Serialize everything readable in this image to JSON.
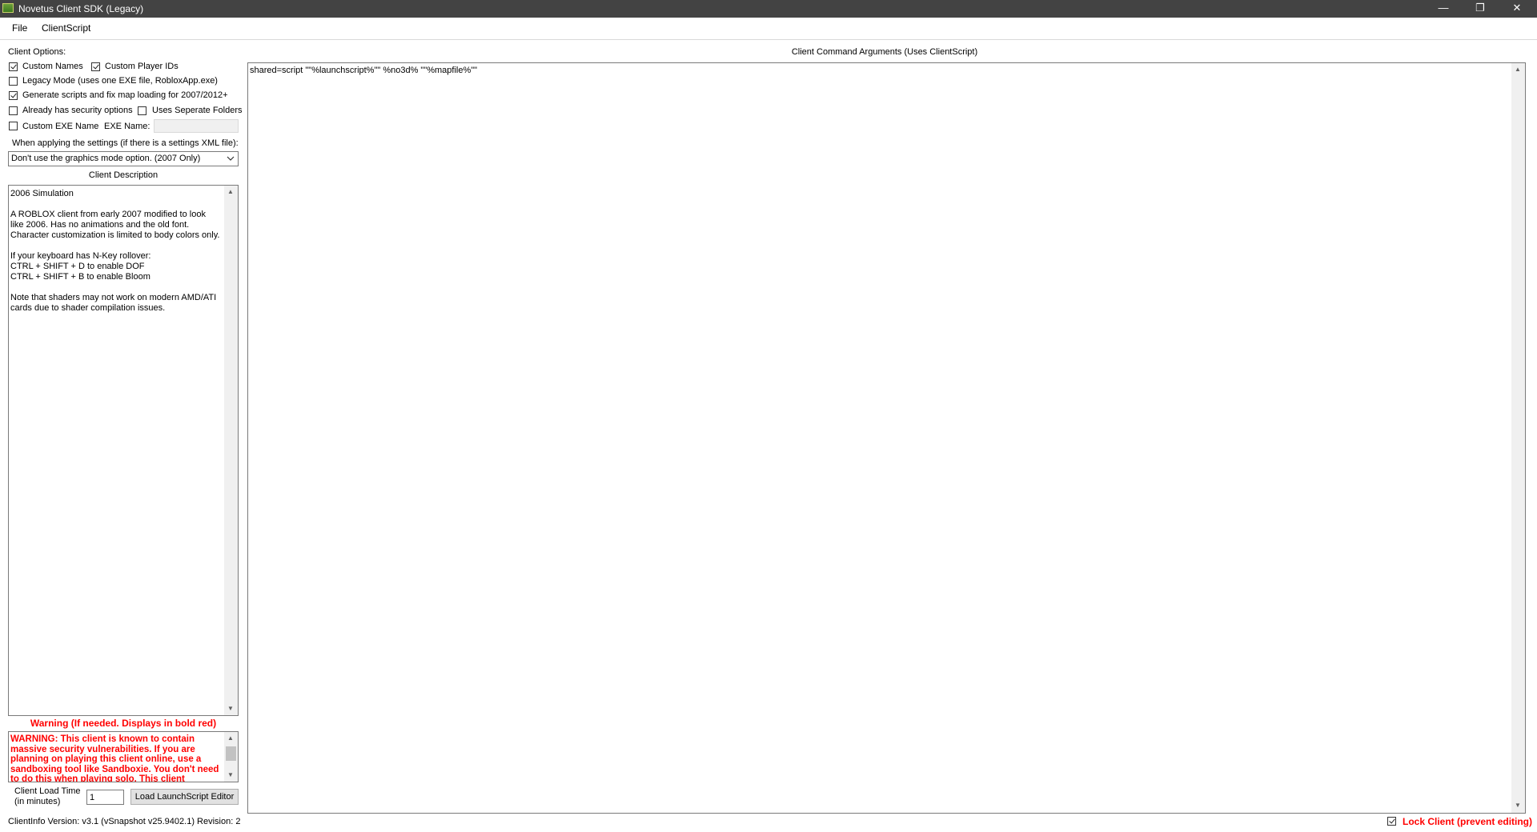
{
  "window": {
    "title": "Novetus Client SDK (Legacy)",
    "controls": {
      "minimize": "—",
      "restore": "❐",
      "close": "✕"
    }
  },
  "menu": {
    "items": [
      "File",
      "ClientScript"
    ]
  },
  "options": {
    "heading": "Client Options:",
    "custom_names": {
      "label": "Custom Names",
      "checked": true
    },
    "custom_player_ids": {
      "label": "Custom Player IDs",
      "checked": true
    },
    "legacy_mode": {
      "label": "Legacy Mode (uses one EXE file, RobloxApp.exe)",
      "checked": false
    },
    "generate_scripts": {
      "label": "Generate scripts and fix map loading for 2007/2012+",
      "checked": true
    },
    "security_options": {
      "label": "Already has security options",
      "checked": false
    },
    "separate_folders": {
      "label": "Uses Seperate Folders",
      "checked": false
    },
    "custom_exe_name": {
      "label": "Custom EXE Name",
      "checked": false
    },
    "exe_name_label": "EXE Name:",
    "exe_name_value": ""
  },
  "settings": {
    "label": "When applying the settings (if there is a settings XML file):",
    "selected": "Don't use the graphics mode option. (2007 Only)"
  },
  "description": {
    "heading": "Client Description",
    "text": "2006 Simulation\n\nA ROBLOX client from early 2007 modified to look like 2006. Has no animations and the old font. Character customization is limited to body colors only.\n\nIf your keyboard has N-Key rollover:\nCTRL + SHIFT + D to enable DOF\nCTRL + SHIFT + B to enable Bloom\n\nNote that shaders may not work on modern AMD/ATI cards due to shader compilation issues."
  },
  "warning": {
    "heading": "Warning (If needed. Displays in bold red)",
    "text": "WARNING: This client is known to contain massive security vulnerabilities. If you are planning on playing this client online, use a sandboxing tool like Sandboxie. You don't need to do this when playing solo. This client"
  },
  "load_time": {
    "label_line1": "Client Load Time",
    "label_line2": "(in minutes)",
    "value": "1"
  },
  "load_editor_button": "Load LaunchScript Editor",
  "command": {
    "heading": "Client Command Arguments (Uses ClientScript)",
    "text": "shared=script \"\"%launchscript%\"\" %no3d% \"\"%mapfile%\"\""
  },
  "footer": {
    "version": "ClientInfo Version:  v3.1 (vSnapshot v25.9402.1) Revision: 2",
    "lock_label": "Lock Client (prevent editing)",
    "lock_checked": true
  },
  "colors": {
    "titlebar": "#434343",
    "warning": "#ff0000",
    "control_bg": "#e1e1e1"
  }
}
